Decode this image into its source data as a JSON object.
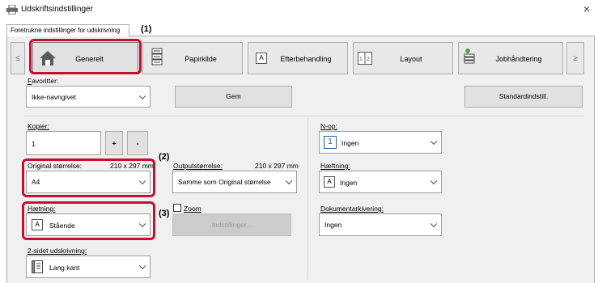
{
  "window": {
    "title": "Udskriftsindstillinger",
    "close_glyph": "×"
  },
  "tab": {
    "label": "Foretrukne indstillinger for udskrivning"
  },
  "nav": {
    "left_arrow": "≤",
    "right_arrow": "≥",
    "items": [
      {
        "label": "Generelt",
        "icon": "home-icon"
      },
      {
        "label": "Papirkilde",
        "icon": "paper-source-icon"
      },
      {
        "label": "Efterbehandling",
        "icon": "finishing-icon"
      },
      {
        "label": "Layout",
        "icon": "layout-icon"
      },
      {
        "label": "Jobhåndtering",
        "icon": "job-handling-icon"
      }
    ]
  },
  "callouts": {
    "c1": "(1)",
    "c2": "(2)",
    "c3": "(3)"
  },
  "favorites": {
    "label": "Favoritter:",
    "value": "Ikke-navngivet",
    "save": "Gem",
    "defaults": "Standardindstill."
  },
  "copies": {
    "label": "Kopier:",
    "value": "1",
    "plus": "+",
    "minus": "-"
  },
  "original_size": {
    "label": "Original størrelse:",
    "dims": "210 x 297 mm",
    "value": "A4"
  },
  "output_size": {
    "label": "Outputstørrelse:",
    "dims": "210 x 297 mm",
    "value": "Samme som Original størrelse"
  },
  "orientation": {
    "label": "Hætning:",
    "value": "Stående",
    "icon_glyph": "A"
  },
  "zoom": {
    "label": "Zoom",
    "settings_button": "Indstillinger..."
  },
  "duplex": {
    "label": "2-sidet udskrivning:",
    "value": "Lang kant"
  },
  "nup": {
    "label": "N-op:",
    "value": "Ingen",
    "icon_glyph": "1"
  },
  "stapling": {
    "label": "Hæftning:",
    "value": "Ingen",
    "icon_glyph": "A"
  },
  "doc_filing": {
    "label": "Dokumentarkivering:",
    "value": "Ingen"
  },
  "colors": {
    "accent_red": "#c8102e",
    "panel": "#f0f0f0"
  }
}
